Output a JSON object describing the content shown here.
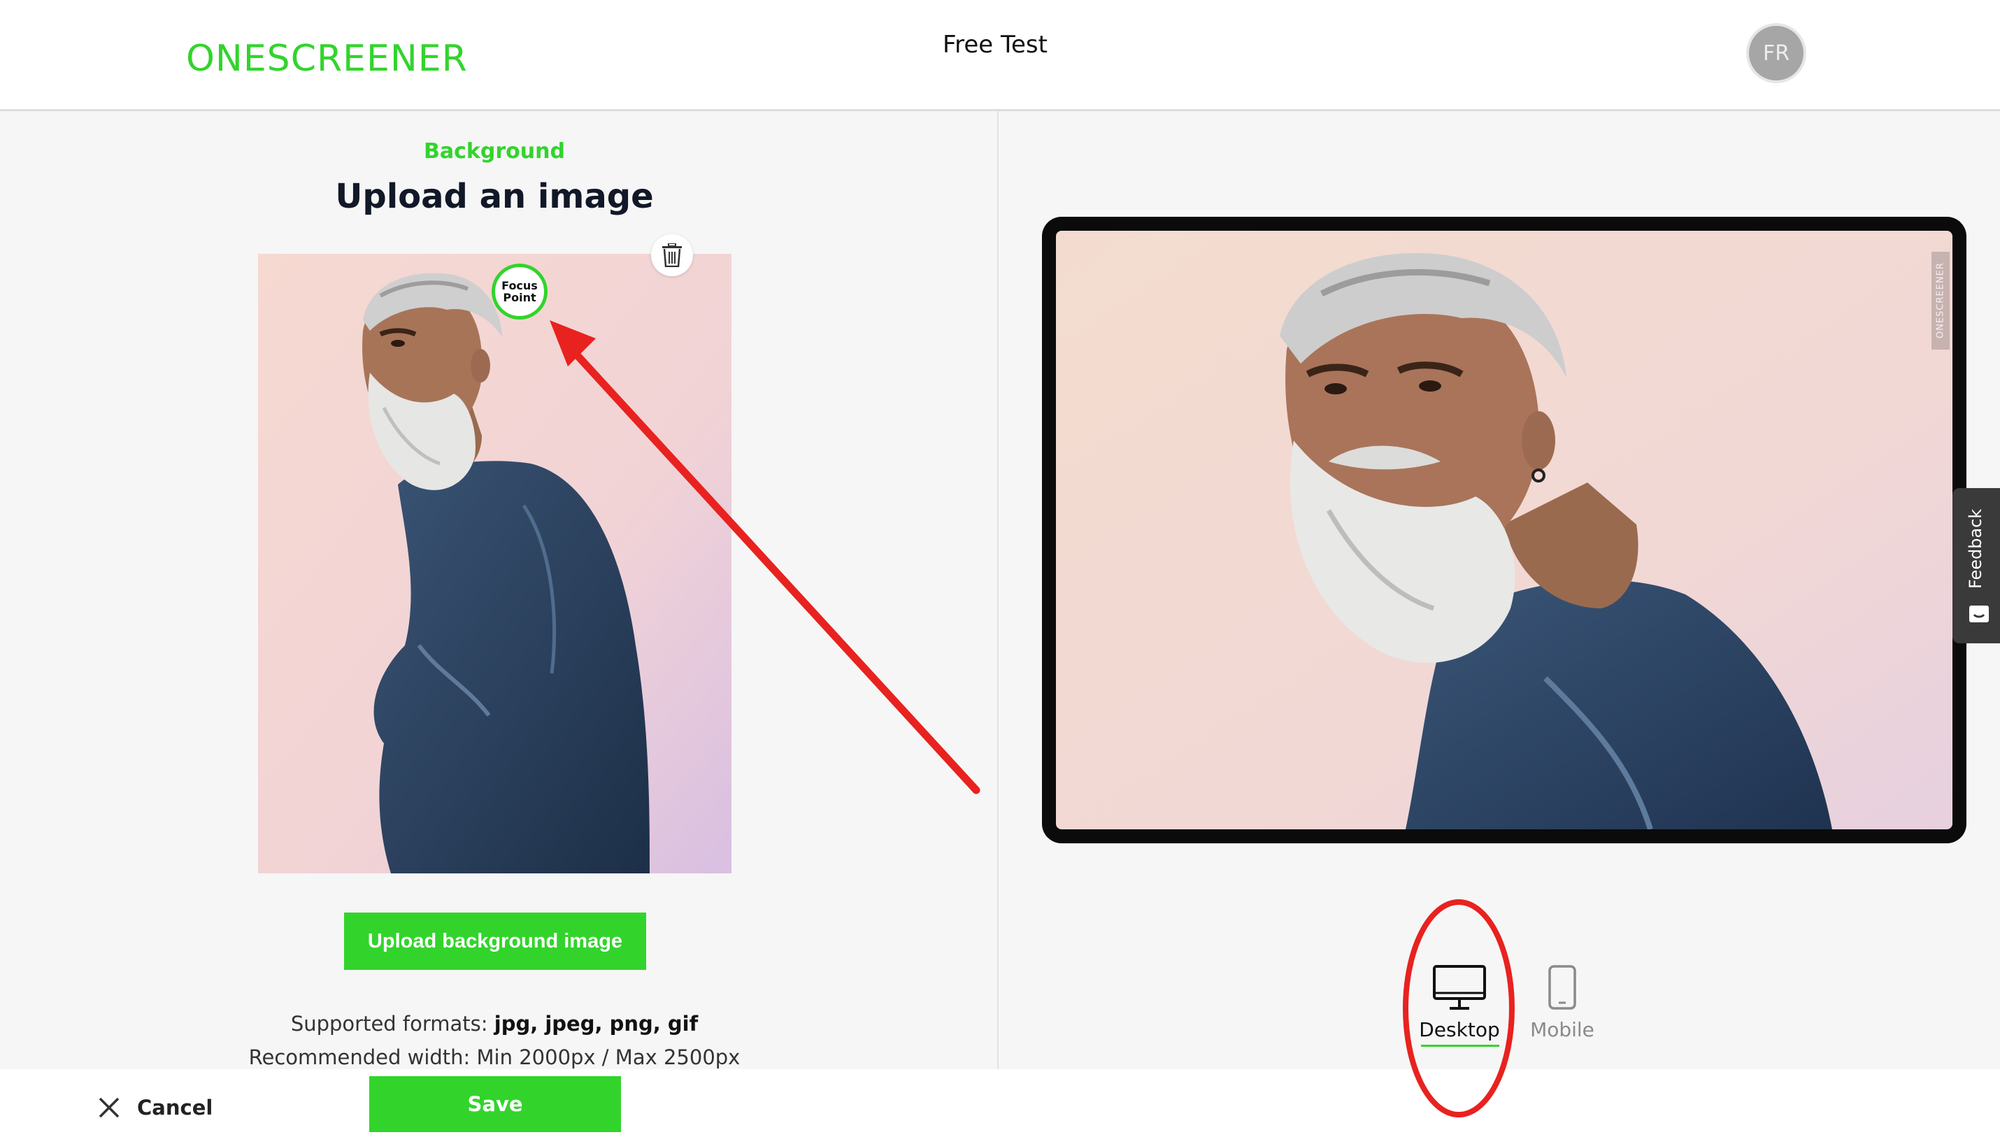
{
  "header": {
    "logo": "ONESCREENER",
    "title": "Free Test",
    "avatar_initials": "FR"
  },
  "editor": {
    "section_label": "Background",
    "section_title": "Upload an image",
    "focus_point_line1": "Focus",
    "focus_point_line2": "Point",
    "trash_icon": "trash-icon",
    "upload_button": "Upload background image",
    "formats_prefix": "Supported formats:",
    "formats_values": "jpg, jpeg, png, gif",
    "recommended_width": "Recommended width: Min 2000px / Max 2500px"
  },
  "preview": {
    "watermark": "ONESCREENER",
    "feedback_label": "Feedback",
    "devices": [
      {
        "label": "Desktop",
        "icon": "desktop-monitor-icon",
        "selected": true
      },
      {
        "label": "Mobile",
        "icon": "mobile-phone-icon",
        "selected": false
      }
    ]
  },
  "footer": {
    "cancel_label": "Cancel",
    "save_label": "Save"
  },
  "colors": {
    "accent": "#32d42c",
    "annotation": "#e8221f",
    "frame": "#0b0b0b"
  }
}
